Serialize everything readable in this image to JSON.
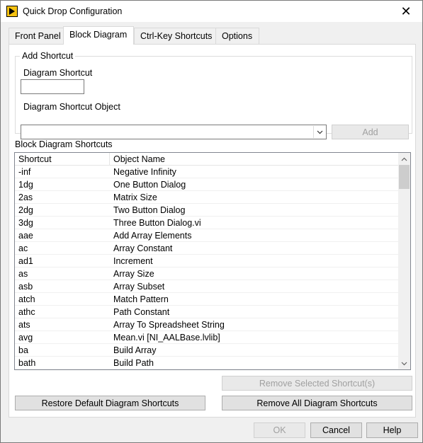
{
  "window": {
    "title": "Quick Drop Configuration"
  },
  "tabs": [
    {
      "label": "Front Panel"
    },
    {
      "label": "Block Diagram"
    },
    {
      "label": "Ctrl-Key Shortcuts"
    },
    {
      "label": "Options"
    }
  ],
  "add_shortcut": {
    "group_title": "Add Shortcut",
    "shortcut_label": "Diagram Shortcut",
    "shortcut_value": "",
    "object_label": "Diagram Shortcut Object",
    "object_value": "",
    "add_button": "Add"
  },
  "shortcuts": {
    "section_title": "Block Diagram Shortcuts",
    "columns": [
      "Shortcut",
      "Object Name"
    ],
    "rows": [
      [
        "-inf",
        "Negative Infinity"
      ],
      [
        "1dg",
        "One Button Dialog"
      ],
      [
        "2as",
        "Matrix Size"
      ],
      [
        "2dg",
        "Two Button Dialog"
      ],
      [
        "3dg",
        "Three Button Dialog.vi"
      ],
      [
        "aae",
        "Add Array Elements"
      ],
      [
        "ac",
        "Array Constant"
      ],
      [
        "ad1",
        "Increment"
      ],
      [
        "as",
        "Array Size"
      ],
      [
        "asb",
        "Array Subset"
      ],
      [
        "atch",
        "Match Pattern"
      ],
      [
        "athc",
        "Path Constant"
      ],
      [
        "ats",
        "Array To Spreadsheet String"
      ],
      [
        "avg",
        "Mean.vi [NI_AALBase.lvlib]"
      ],
      [
        "ba",
        "Build Array"
      ],
      [
        "bath",
        "Build Path"
      ]
    ]
  },
  "buttons": {
    "remove_selected": "Remove Selected Shortcut(s)",
    "restore_default": "Restore Default Diagram Shortcuts",
    "remove_all": "Remove All Diagram Shortcuts",
    "ok": "OK",
    "cancel": "Cancel",
    "help": "Help"
  },
  "colors": {
    "accent": "#f5c211",
    "disabled_text": "#a0a0a0"
  }
}
